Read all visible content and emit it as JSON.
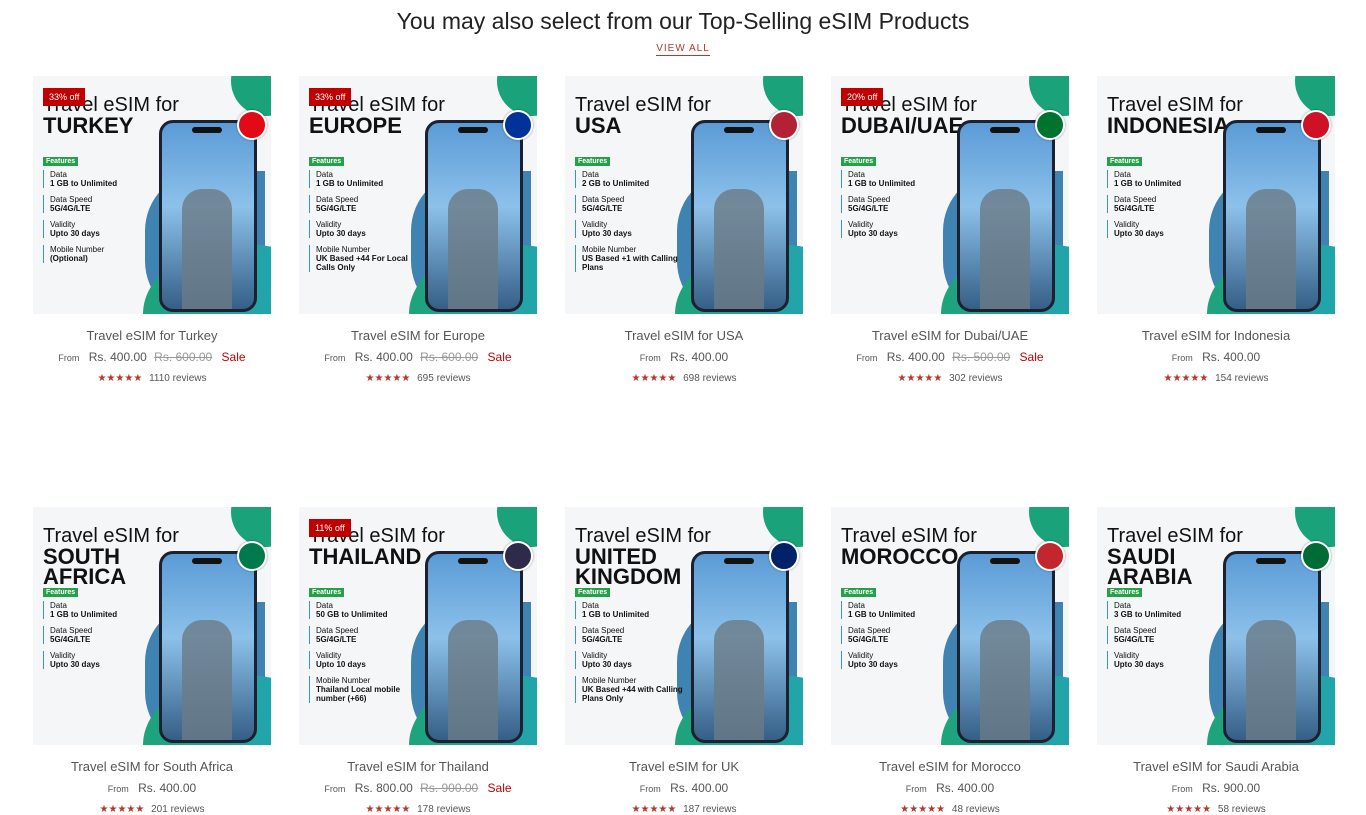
{
  "section": {
    "title": "You may also select from our Top-Selling eSIM Products",
    "view_all": "VIEW ALL"
  },
  "colors": {
    "accent": "#b5372f",
    "sale": "#c00000",
    "badge": "#c00000",
    "feature_badge": "#27a04a"
  },
  "products": [
    {
      "title": "Travel eSIM for Turkey",
      "img_line1": "Travel eSIM for",
      "img_line2": "TURKEY",
      "discount": "33% off",
      "from": "From",
      "price": "Rs. 400.00",
      "compare": "Rs. 600.00",
      "sale": "Sale",
      "stars": "★★★★★",
      "reviews": "1110 reviews",
      "features_badge": "Features",
      "features": [
        [
          "Data",
          "1 GB to Unlimited"
        ],
        [
          "Data Speed",
          "5G/4G/LTE"
        ],
        [
          "Validity",
          "Upto 30 days"
        ],
        [
          "Mobile Number",
          "(Optional)"
        ]
      ],
      "flag_icon": "turkey-flag-icon",
      "flag_color": "#e30a17"
    },
    {
      "title": "Travel eSIM for Europe",
      "img_line1": "Travel eSIM for",
      "img_line2": "EUROPE",
      "discount": "33% off",
      "from": "From",
      "price": "Rs. 400.00",
      "compare": "Rs. 600.00",
      "sale": "Sale",
      "stars": "★★★★★",
      "reviews": "695 reviews",
      "features_badge": "Features",
      "features": [
        [
          "Data",
          "1 GB to Unlimited"
        ],
        [
          "Data Speed",
          "5G/4G/LTE"
        ],
        [
          "Validity",
          "Upto 30 days"
        ],
        [
          "Mobile Number",
          "UK Based +44 For Local Calls Only"
        ]
      ],
      "flag_icon": "eu-flag-icon",
      "flag_color": "#003399"
    },
    {
      "title": "Travel eSIM for USA",
      "img_line1": "Travel eSIM for",
      "img_line2": "USA",
      "discount": "",
      "from": "From",
      "price": "Rs. 400.00",
      "compare": "",
      "sale": "",
      "stars": "★★★★★",
      "reviews": "698 reviews",
      "features_badge": "Features",
      "features": [
        [
          "Data",
          "2 GB to Unlimited"
        ],
        [
          "Data Speed",
          "5G/4G/LTE"
        ],
        [
          "Validity",
          "Upto 30 days"
        ],
        [
          "Mobile Number",
          "US Based +1 with Calling Plans"
        ]
      ],
      "flag_icon": "usa-flag-icon",
      "flag_color": "#b22234"
    },
    {
      "title": "Travel eSIM for Dubai/UAE",
      "img_line1": "Travel eSIM for",
      "img_line2": "DUBAI/UAE",
      "discount": "20% off",
      "from": "From",
      "price": "Rs. 400.00",
      "compare": "Rs. 500.00",
      "sale": "Sale",
      "stars": "★★★★★",
      "reviews": "302 reviews",
      "features_badge": "Features",
      "features": [
        [
          "Data",
          "1 GB to Unlimited"
        ],
        [
          "Data Speed",
          "5G/4G/LTE"
        ],
        [
          "Validity",
          "Upto 30 days"
        ]
      ],
      "flag_icon": "uae-flag-icon",
      "flag_color": "#00732f"
    },
    {
      "title": "Travel eSIM for Indonesia",
      "img_line1": "Travel eSIM for",
      "img_line2": "INDONESIA",
      "discount": "",
      "from": "From",
      "price": "Rs. 400.00",
      "compare": "",
      "sale": "",
      "stars": "★★★★★",
      "reviews": "154 reviews",
      "features_badge": "Features",
      "features": [
        [
          "Data",
          "1 GB to Unlimited"
        ],
        [
          "Data Speed",
          "5G/4G/LTE"
        ],
        [
          "Validity",
          "Upto 30 days"
        ]
      ],
      "flag_icon": "indonesia-flag-icon",
      "flag_color": "#ce1126"
    },
    {
      "title": "Travel eSIM for South Africa",
      "img_line1": "Travel eSIM for",
      "img_line2": "SOUTH AFRICA",
      "discount": "",
      "from": "From",
      "price": "Rs. 400.00",
      "compare": "",
      "sale": "",
      "stars": "★★★★★",
      "reviews": "201 reviews",
      "features_badge": "Features",
      "features": [
        [
          "Data",
          "1 GB to Unlimited"
        ],
        [
          "Data Speed",
          "5G/4G/LTE"
        ],
        [
          "Validity",
          "Upto 30 days"
        ]
      ],
      "flag_icon": "south-africa-flag-icon",
      "flag_color": "#007a4d"
    },
    {
      "title": "Travel eSIM for Thailand",
      "img_line1": "Travel eSIM for",
      "img_line2": "THAILAND",
      "discount": "11% off",
      "from": "From",
      "price": "Rs. 800.00",
      "compare": "Rs. 900.00",
      "sale": "Sale",
      "stars": "★★★★★",
      "reviews": "178 reviews",
      "features_badge": "Features",
      "features": [
        [
          "Data",
          "50 GB to Unlimited"
        ],
        [
          "Data Speed",
          "5G/4G/LTE"
        ],
        [
          "Validity",
          "Upto 10 days"
        ],
        [
          "Mobile Number",
          "Thailand Local mobile number (+66)"
        ]
      ],
      "flag_icon": "thailand-flag-icon",
      "flag_color": "#2d2a4a"
    },
    {
      "title": "Travel eSIM for UK",
      "img_line1": "Travel eSIM for",
      "img_line2": "UNITED KINGDOM",
      "discount": "",
      "from": "From",
      "price": "Rs. 400.00",
      "compare": "",
      "sale": "",
      "stars": "★★★★★",
      "reviews": "187 reviews",
      "features_badge": "Features",
      "features": [
        [
          "Data",
          "1 GB to Unlimited"
        ],
        [
          "Data Speed",
          "5G/4G/LTE"
        ],
        [
          "Validity",
          "Upto 30 days"
        ],
        [
          "Mobile Number",
          "UK Based +44 with Calling Plans Only"
        ]
      ],
      "flag_icon": "uk-flag-icon",
      "flag_color": "#012169"
    },
    {
      "title": "Travel eSIM for Morocco",
      "img_line1": "Travel eSIM for",
      "img_line2": "MOROCCO",
      "discount": "",
      "from": "From",
      "price": "Rs. 400.00",
      "compare": "",
      "sale": "",
      "stars": "★★★★★",
      "reviews": "48 reviews",
      "features_badge": "Features",
      "features": [
        [
          "Data",
          "1 GB to Unlimited"
        ],
        [
          "Data Speed",
          "5G/4G/LTE"
        ],
        [
          "Validity",
          "Upto 30 days"
        ]
      ],
      "flag_icon": "morocco-flag-icon",
      "flag_color": "#c1272d"
    },
    {
      "title": "Travel eSIM for Saudi Arabia",
      "img_line1": "Travel eSIM for",
      "img_line2": "SAUDI ARABIA",
      "discount": "",
      "from": "From",
      "price": "Rs. 900.00",
      "compare": "",
      "sale": "",
      "stars": "★★★★★",
      "reviews": "58 reviews",
      "features_badge": "Features",
      "features": [
        [
          "Data",
          "3 GB to Unlimited"
        ],
        [
          "Data Speed",
          "5G/4G/LTE"
        ],
        [
          "Validity",
          "Upto 30 days"
        ]
      ],
      "flag_icon": "saudi-flag-icon",
      "flag_color": "#006c35"
    }
  ]
}
